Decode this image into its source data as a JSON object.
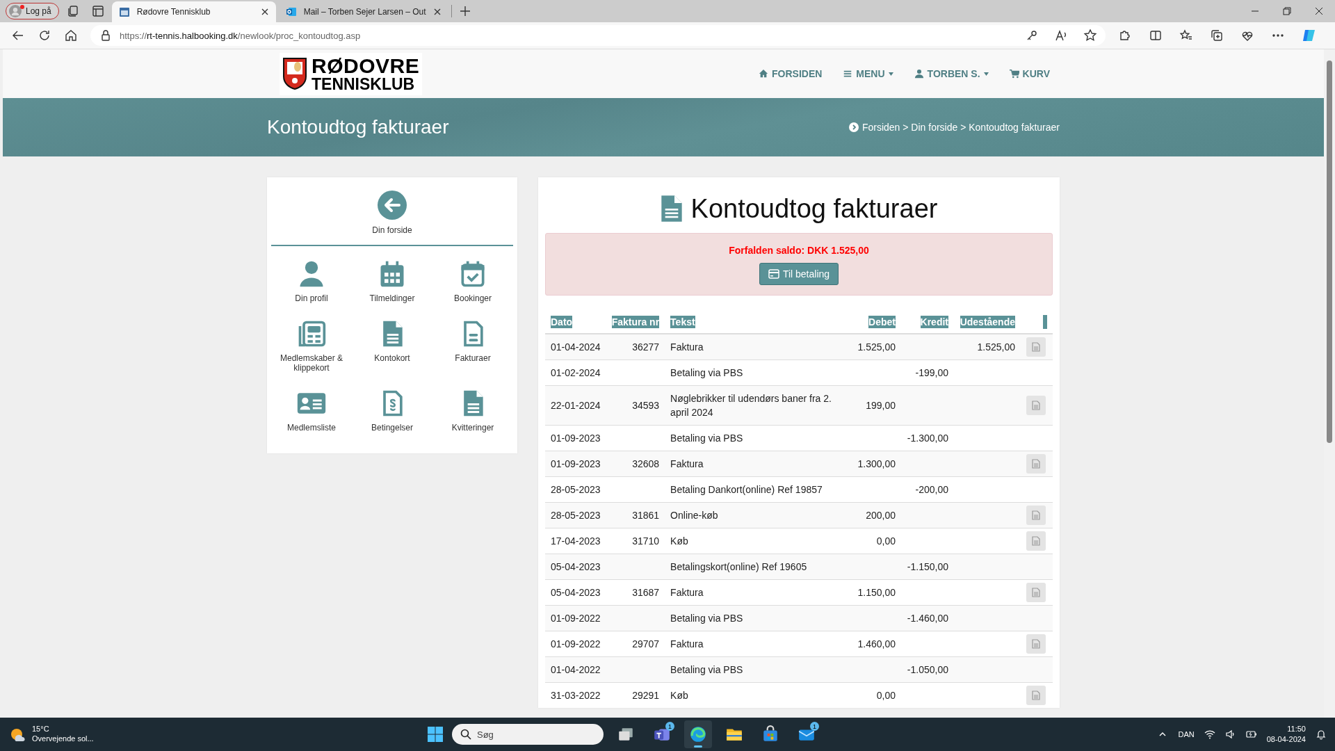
{
  "browser": {
    "profile_button": "Log på",
    "tabs": [
      {
        "title": "Rødovre Tennisklub",
        "kind": "site",
        "selected": true
      },
      {
        "title": "Mail – Torben Sejer Larsen – Out",
        "kind": "mail",
        "selected": false
      }
    ],
    "url": {
      "scheme": "https://",
      "host": "rt-tennis.halbooking.dk",
      "path": "/newlook/proc_kontoudtog.asp"
    }
  },
  "site": {
    "logo": [
      "RØDOVRE",
      "TENNISKLUB"
    ],
    "nav": [
      {
        "label": "FORSIDEN",
        "kind": "home",
        "dropdown": false
      },
      {
        "label": "MENU",
        "kind": "menu",
        "dropdown": true
      },
      {
        "label": "TORBEN S.",
        "kind": "user",
        "dropdown": true
      },
      {
        "label": "KURV",
        "kind": "cart",
        "dropdown": false
      }
    ],
    "page_title": "Kontoudtog fakturaer",
    "breadcrumb": "Forsiden > Din forside > Kontoudtog fakturaer"
  },
  "sidebar": {
    "back": "Din forside",
    "items": [
      {
        "label": "Din profil",
        "kind": "person"
      },
      {
        "label": "Tilmeldinger",
        "kind": "calendar"
      },
      {
        "label": "Bookinger",
        "kind": "calendar-check"
      },
      {
        "label": "Medlemskaber & klippekort",
        "kind": "newspaper"
      },
      {
        "label": "Kontokort",
        "kind": "file"
      },
      {
        "label": "Fakturaer",
        "kind": "file-outline"
      },
      {
        "label": "Medlemsliste",
        "kind": "id-card"
      },
      {
        "label": "Betingelser",
        "kind": "file-paragraph"
      },
      {
        "label": "Kvitteringer",
        "kind": "file"
      }
    ]
  },
  "main": {
    "title": "Kontoudtog fakturaer",
    "alert": {
      "text": "Forfalden saldo: DKK 1.525,00",
      "button": "Til betaling"
    },
    "table": {
      "columns": [
        "Dato",
        "Faktura nr",
        "Tekst",
        "Debet",
        "Kredit",
        "Udestående"
      ],
      "rows": [
        {
          "date": "01-04-2024",
          "invoice": "36277",
          "text": "Faktura",
          "debet": "1.525,00",
          "outstanding": "1.525,00",
          "pdf": true
        },
        {
          "date": "01-02-2024",
          "text": "Betaling via PBS",
          "kredit": "-199,00",
          "pdf": false
        },
        {
          "date": "22-01-2024",
          "invoice": "34593",
          "text": "Nøglebrikker til udendørs baner fra 2. april 2024",
          "debet": "199,00",
          "pdf": true
        },
        {
          "date": "01-09-2023",
          "text": "Betaling via PBS",
          "kredit": "-1.300,00",
          "pdf": false
        },
        {
          "date": "01-09-2023",
          "invoice": "32608",
          "text": "Faktura",
          "debet": "1.300,00",
          "pdf": true
        },
        {
          "date": "28-05-2023",
          "text": "Betaling Dankort(online) Ref 19857",
          "kredit": "-200,00",
          "pdf": false
        },
        {
          "date": "28-05-2023",
          "invoice": "31861",
          "text": "Online-køb",
          "debet": "200,00",
          "pdf": true
        },
        {
          "date": "17-04-2023",
          "invoice": "31710",
          "text": "Køb",
          "debet": "0,00",
          "pdf": true
        },
        {
          "date": "05-04-2023",
          "text": "Betalingskort(online) Ref 19605",
          "kredit": "-1.150,00",
          "pdf": false
        },
        {
          "date": "05-04-2023",
          "invoice": "31687",
          "text": "Faktura",
          "debet": "1.150,00",
          "pdf": true
        },
        {
          "date": "01-09-2022",
          "text": "Betaling via PBS",
          "kredit": "-1.460,00",
          "pdf": false
        },
        {
          "date": "01-09-2022",
          "invoice": "29707",
          "text": "Faktura",
          "debet": "1.460,00",
          "pdf": true
        },
        {
          "date": "01-04-2022",
          "text": "Betaling via PBS",
          "kredit": "-1.050,00",
          "pdf": false
        },
        {
          "date": "31-03-2022",
          "invoice": "29291",
          "text": "Køb",
          "debet": "0,00",
          "pdf": true
        }
      ]
    }
  },
  "taskbar": {
    "weather": {
      "temp": "15°C",
      "text": "Overvejende sol..."
    },
    "search_placeholder": "Søg",
    "apps": [
      {
        "kind": "taskview",
        "active": false
      },
      {
        "kind": "teams",
        "active": false,
        "badge": "1"
      },
      {
        "kind": "edge",
        "active": true
      },
      {
        "kind": "explorer",
        "active": false
      },
      {
        "kind": "store",
        "active": false
      },
      {
        "kind": "mail",
        "active": false,
        "badge": "1"
      }
    ],
    "language": "DAN",
    "time": "11:50",
    "date": "08-04-2024"
  }
}
